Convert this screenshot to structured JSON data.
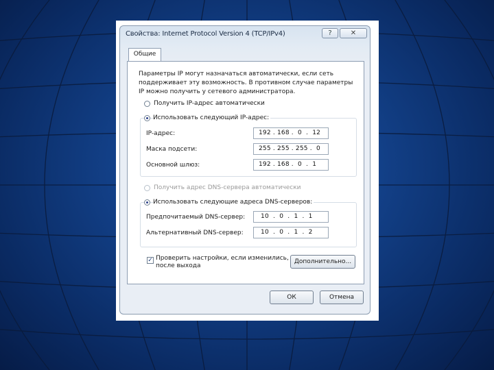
{
  "window": {
    "title": "Свойства: Internet Protocol Version 4 (TCP/IPv4)",
    "help_label": "?",
    "close_label": "✕"
  },
  "tabs": [
    {
      "label": "Общие"
    }
  ],
  "description": [
    "Параметры IP могут назначаться автоматически, если сеть",
    "поддерживает эту возможность. В противном случае параметры",
    "IP можно получить у сетевого администратора."
  ],
  "ip": {
    "auto_label": "Получить IP-адрес автоматически",
    "manual_label": "Использовать следующий IP-адрес:",
    "selected": "manual",
    "fields": [
      {
        "label": "IP-адрес:",
        "value": "192 . 168 .  0  .  12"
      },
      {
        "label": "Маска подсети:",
        "value": "255 . 255 . 255 .  0"
      },
      {
        "label": "Основной шлюз:",
        "value": "192 . 168 .  0  .  1"
      }
    ]
  },
  "dns": {
    "auto_label": "Получить адрес DNS-сервера автоматически",
    "manual_label": "Использовать следующие адреса DNS-серверов:",
    "selected": "manual",
    "fields": [
      {
        "label": "Предпочитаемый DNS-сервер:",
        "value": " 10  .  0  .  1  .  1"
      },
      {
        "label": "Альтернативный DNS-сервер:",
        "value": " 10  .  0  .  1  .  2"
      }
    ]
  },
  "validate": {
    "checked": true,
    "label_line1": "Проверить настройки, если изменились,",
    "label_line2": "после выхода"
  },
  "buttons": {
    "advanced": "Дополнительно...",
    "ok": "ОК",
    "cancel": "Отмена"
  }
}
